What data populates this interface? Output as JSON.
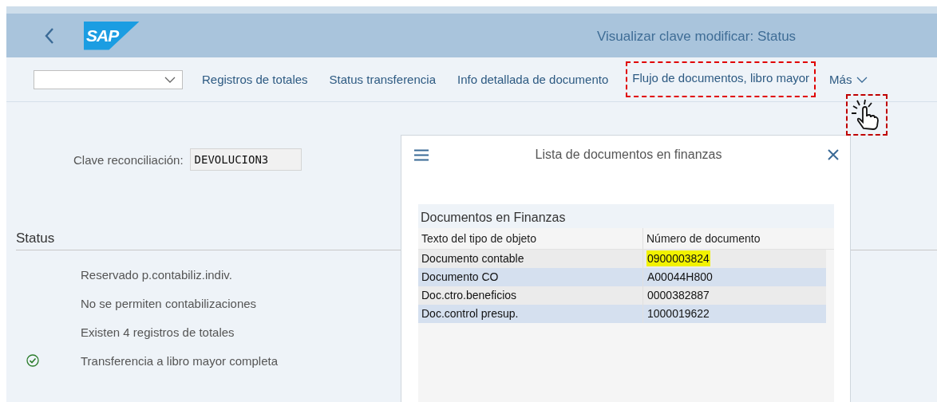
{
  "header": {
    "logo": "SAP",
    "title": "Visualizar clave modificar: Status"
  },
  "toolbar": {
    "items": [
      {
        "label": "Registros de totales",
        "highlighted": false
      },
      {
        "label": "Status transferencia",
        "highlighted": false
      },
      {
        "label": "Info detallada de documento",
        "highlighted": false
      },
      {
        "label": "Flujo de documentos, libro mayor",
        "highlighted": true
      }
    ],
    "more": "Más"
  },
  "form": {
    "label": "Clave reconciliación:",
    "value": "DEVOLUCION3"
  },
  "status": {
    "heading": "Status",
    "items": [
      {
        "kind": "text",
        "text": "Reservado p.contabiliz.indiv."
      },
      {
        "kind": "text",
        "text": "No se permiten contabilizaciones"
      },
      {
        "kind": "text",
        "text": "Existen 4 registros de totales"
      },
      {
        "kind": "success",
        "text": "Transferencia a libro mayor completa"
      }
    ]
  },
  "dialog": {
    "title": "Lista de documentos en finanzas",
    "table": {
      "title": "Documentos en Finanzas",
      "columns": [
        "Texto del tipo de objeto",
        "Número de documento"
      ],
      "rows": [
        {
          "type": "Documento contable",
          "number": "0900003824",
          "highlighted": true
        },
        {
          "type": "Documento CO",
          "number": "A00044H800",
          "highlighted": false
        },
        {
          "type": "Doc.ctro.beneficios",
          "number": "0000382887",
          "highlighted": false
        },
        {
          "type": "Doc.control presup.",
          "number": "1000019622",
          "highlighted": false
        }
      ]
    }
  }
}
